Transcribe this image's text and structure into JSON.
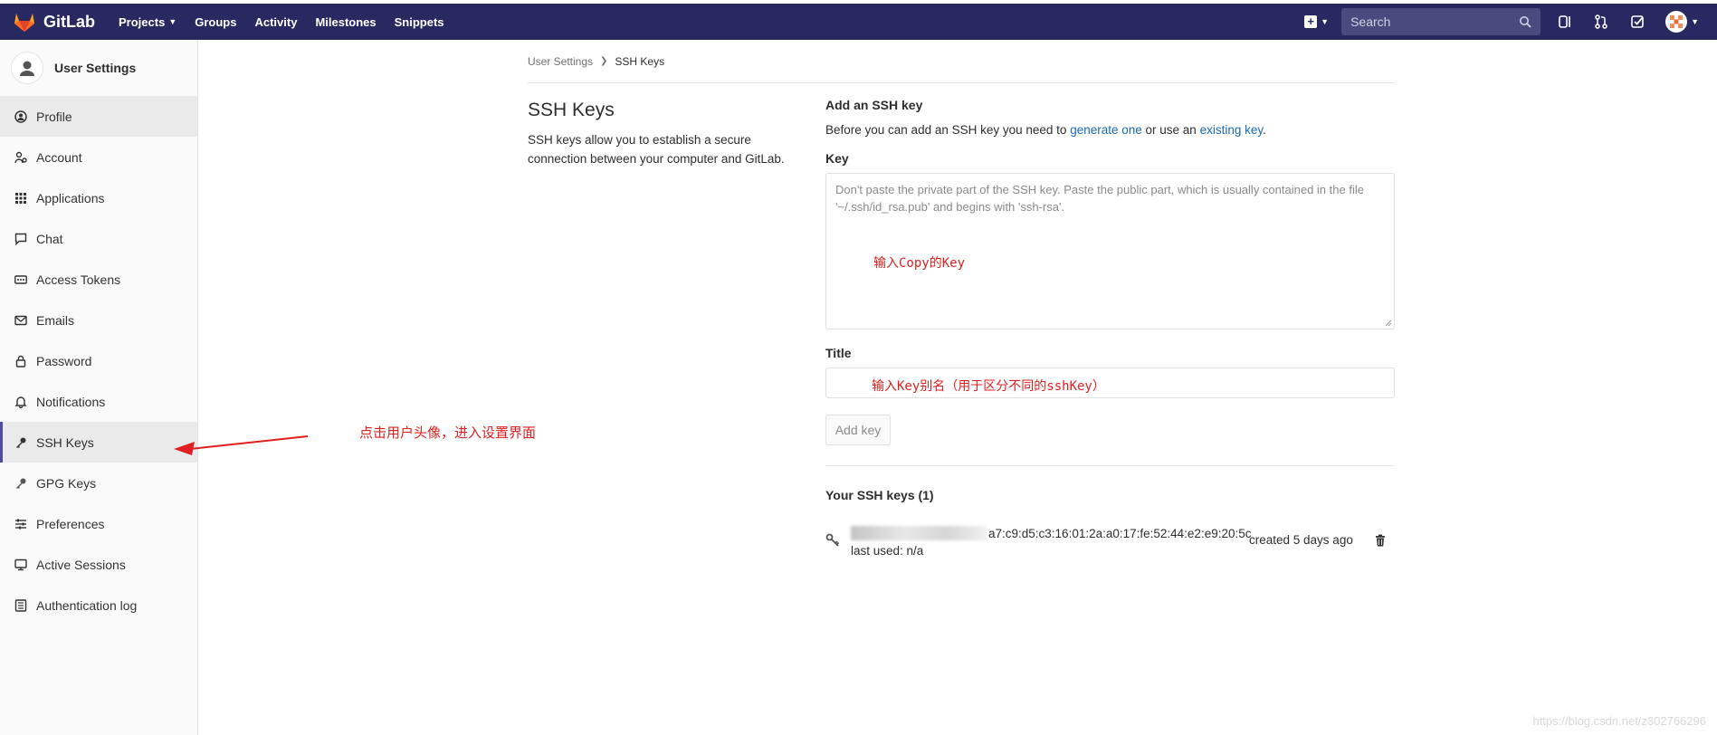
{
  "topbar": {
    "brand": "GitLab",
    "nav": [
      {
        "label": "Projects",
        "has_caret": true
      },
      {
        "label": "Groups"
      },
      {
        "label": "Activity"
      },
      {
        "label": "Milestones"
      },
      {
        "label": "Snippets"
      }
    ],
    "search_placeholder": "Search",
    "bg_color": "#292961"
  },
  "sidebar": {
    "title": "User Settings",
    "items": [
      {
        "label": "Profile",
        "icon": "profile-icon"
      },
      {
        "label": "Account",
        "icon": "account-icon"
      },
      {
        "label": "Applications",
        "icon": "applications-icon"
      },
      {
        "label": "Chat",
        "icon": "chat-icon"
      },
      {
        "label": "Access Tokens",
        "icon": "token-icon"
      },
      {
        "label": "Emails",
        "icon": "mail-icon"
      },
      {
        "label": "Password",
        "icon": "lock-icon"
      },
      {
        "label": "Notifications",
        "icon": "bell-icon"
      },
      {
        "label": "SSH Keys",
        "icon": "key-icon",
        "active": true
      },
      {
        "label": "GPG Keys",
        "icon": "key-icon"
      },
      {
        "label": "Preferences",
        "icon": "sliders-icon"
      },
      {
        "label": "Active Sessions",
        "icon": "monitor-icon"
      },
      {
        "label": "Authentication log",
        "icon": "log-icon"
      }
    ]
  },
  "breadcrumb": {
    "parent": "User Settings",
    "current": "SSH Keys"
  },
  "left": {
    "title": "SSH Keys",
    "description": "SSH keys allow you to establish a secure connection between your computer and GitLab."
  },
  "form": {
    "heading": "Add an SSH key",
    "intro_before": "Before you can add an SSH key you need to ",
    "link_generate": "generate one",
    "intro_middle": " or use an ",
    "link_existing": "existing key",
    "intro_after": ".",
    "key_label": "Key",
    "key_placeholder": "Don't paste the private part of the SSH key. Paste the public part, which is usually contained in the file '~/.ssh/id_rsa.pub' and begins with 'ssh-rsa'.",
    "title_label": "Title",
    "add_button": "Add key"
  },
  "keys": {
    "heading": "Your SSH keys (1)",
    "list": [
      {
        "fingerprint": "a7:c9:d5:c3:16:01:2a:a0:17:fe:52:44:e2:e9:20:5c",
        "last_used": "last used: n/a",
        "created": "created 5 days ago"
      }
    ]
  },
  "annotations": {
    "key_hint": "输入Copy的Key",
    "title_hint": "输入Key别名（用于区分不同的sshKey）",
    "main_hint": "点击用户头像，进入设置界面",
    "color": "#e02020"
  },
  "watermark": "https://blog.csdn.net/z302766296"
}
